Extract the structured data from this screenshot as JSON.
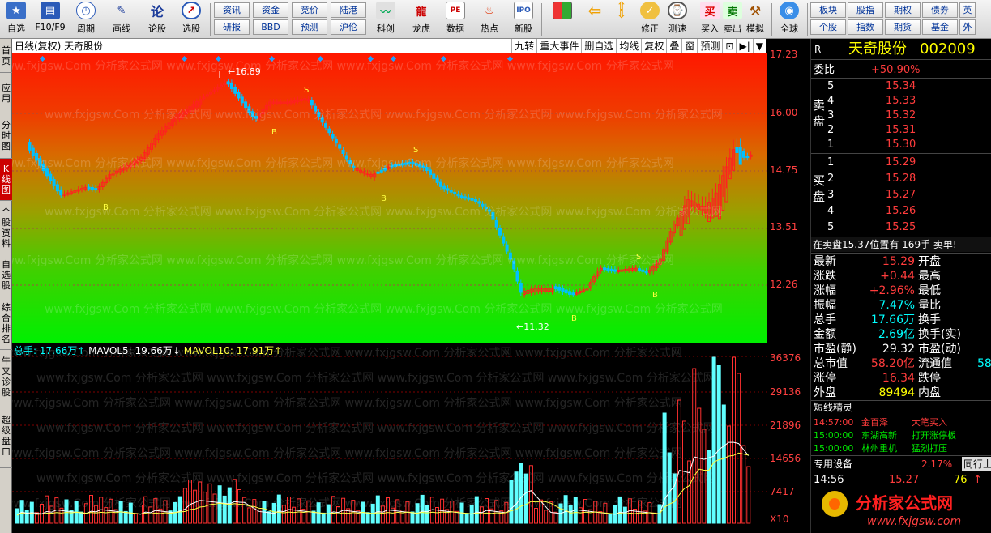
{
  "toolbar": {
    "buttons": [
      {
        "label": "自选",
        "icon": "star-icon"
      },
      {
        "label": "F10/F9",
        "icon": "f10-icon"
      },
      {
        "label": "周期",
        "icon": "clock-icon"
      },
      {
        "label": "画线",
        "icon": "pencil-icon"
      },
      {
        "label": "论股",
        "icon": "discuss-icon"
      },
      {
        "label": "选股",
        "icon": "select-icon"
      }
    ],
    "grid1": [
      "资讯",
      "资金",
      "竞价",
      "陆港",
      "研报",
      "BBD",
      "预测",
      "沪伦"
    ],
    "buttons2": [
      {
        "label": "科创",
        "icon": "star-market-icon"
      },
      {
        "label": "龙虎",
        "icon": "dragon-tiger-icon"
      },
      {
        "label": "数据",
        "icon": "data-icon"
      },
      {
        "label": "热点",
        "icon": "hot-icon"
      },
      {
        "label": "新股",
        "icon": "ipo-icon"
      }
    ],
    "buttons3": [
      {
        "label": "",
        "icon": "layout-icon"
      },
      {
        "label": "",
        "icon": "back-arrow-icon"
      },
      {
        "label": "修正",
        "icon": "correct-icon"
      },
      {
        "label": "测速",
        "icon": "speed-icon"
      },
      {
        "label": "买入",
        "icon": "buy-icon"
      },
      {
        "label": "卖出",
        "icon": "sell-icon"
      },
      {
        "label": "模拟",
        "icon": "simulate-icon"
      },
      {
        "label": "全球",
        "icon": "globe-icon"
      }
    ],
    "grid2": [
      "板块",
      "股指",
      "期权",
      "债券",
      "英",
      "个股",
      "指数",
      "期货",
      "基金",
      "外"
    ]
  },
  "left_tabs": [
    "首页",
    "应用",
    "分时图",
    "K线图",
    "个股资料",
    "自选股",
    "综合排名",
    "牛叉诊股",
    "超级盘口"
  ],
  "chart": {
    "title": "日线(复权) 天奇股份",
    "header_buttons": [
      "九转",
      "重大事件",
      "删自选",
      "均线",
      "复权",
      "叠",
      "窗",
      "预测",
      "⊡",
      "▶|",
      "▼"
    ],
    "price_ticks": [
      "17.23",
      "16.00",
      "14.75",
      "13.51",
      "12.26"
    ],
    "high_label": "16.89",
    "low_label": "11.32",
    "vol_header": {
      "total": "总手: 17.66万",
      "mavol5": "MAVOL5: 19.66万",
      "mavol10": "MAVOL10: 17.91万"
    },
    "vol_ticks": [
      "36376",
      "29136",
      "21896",
      "14656",
      "7417",
      "X10"
    ],
    "watermark_text": "www.fxjgsw.Com 分析家公式网"
  },
  "stock": {
    "name": "天奇股份",
    "code": "002009",
    "flag": "R"
  },
  "order_book": {
    "weibi_label": "委比",
    "weibi_value": "+50.90%",
    "sell_label": "卖盘",
    "buy_label": "买盘",
    "sell": [
      {
        "n": "5",
        "p": "15.34"
      },
      {
        "n": "4",
        "p": "15.33"
      },
      {
        "n": "3",
        "p": "15.32"
      },
      {
        "n": "2",
        "p": "15.31"
      },
      {
        "n": "1",
        "p": "15.30"
      }
    ],
    "buy": [
      {
        "n": "1",
        "p": "15.29"
      },
      {
        "n": "2",
        "p": "15.28"
      },
      {
        "n": "3",
        "p": "15.27"
      },
      {
        "n": "4",
        "p": "15.26"
      },
      {
        "n": "5",
        "p": "15.25"
      }
    ],
    "status_line": "在卖盘15.37位置有 169手 卖单!"
  },
  "quote": {
    "rows": [
      {
        "l": "最新",
        "v": "15.29",
        "r": "开盘"
      },
      {
        "l": "涨跌",
        "v": "+0.44",
        "r": "最高"
      },
      {
        "l": "涨幅",
        "v": "+2.96%",
        "r": "最低"
      },
      {
        "l": "振幅",
        "v": "7.47%",
        "r": "量比"
      },
      {
        "l": "总手",
        "v": "17.66万",
        "r": "换手"
      },
      {
        "l": "金额",
        "v": "2.69亿",
        "r": "换手(实)"
      },
      {
        "l": "市盈(静)",
        "v": "29.32",
        "r": "市盈(动)"
      },
      {
        "l": "总市值",
        "v": "58.20亿",
        "r": "流通值",
        "x": "58"
      },
      {
        "l": "涨停",
        "v": "16.34",
        "r": "跌停"
      },
      {
        "l": "外盘",
        "v": "89494",
        "r": "内盘"
      }
    ]
  },
  "sprite": {
    "title": "短线精灵",
    "items": [
      {
        "t": "14:57:00",
        "s": "金百泽",
        "e": "大笔买入"
      },
      {
        "t": "15:00:00",
        "s": "东湖高新",
        "e": "打开涨停板"
      },
      {
        "t": "15:00:00",
        "s": "林州重机",
        "e": "猛烈打压"
      }
    ]
  },
  "bottom": {
    "label": "专用设备",
    "pct": "2.17%",
    "btn": "同行上",
    "time": "14:56",
    "price": "15.27",
    "vol": "76"
  },
  "colors": {
    "up": "#ff3030",
    "down": "#00ffff",
    "panel": "#000000"
  }
}
